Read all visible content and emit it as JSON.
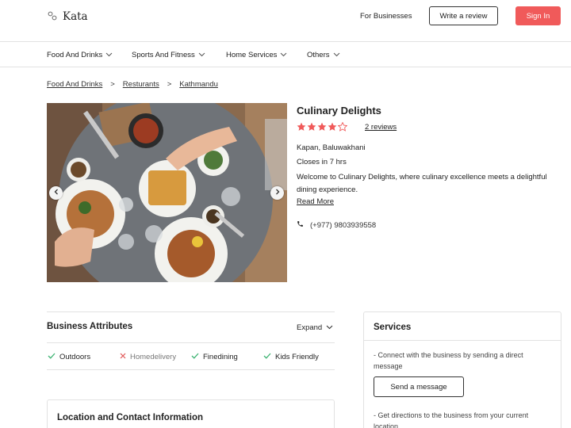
{
  "header": {
    "logo_text": "Kata",
    "for_businesses": "For Businesses",
    "write_review": "Write a review",
    "sign_in": "Sign In"
  },
  "categories": [
    {
      "label": "Food And Drinks",
      "icon": "chevron-down-icon"
    },
    {
      "label": "Sports And Fitness",
      "icon": "chevron-down-icon"
    },
    {
      "label": "Home Services",
      "icon": "chevron-down-icon"
    },
    {
      "label": "Others",
      "icon": "chevron-down-icon"
    }
  ],
  "breadcrumb": {
    "items": [
      "Food And Drinks",
      "Resturants",
      "Kathmandu"
    ],
    "separator": ">"
  },
  "business": {
    "name": "Culinary Delights",
    "rating": 4,
    "rating_max": 5,
    "reviews_label": "2 reviews",
    "address": "Kapan, Baluwakhani",
    "hours_status": "Closes in 7 hrs",
    "description": "Welcome to Culinary Delights, where culinary excellence meets a delightful dining experience.",
    "read_more": "Read More",
    "phone": "(+977) 9803939558"
  },
  "attributes": {
    "title": "Business Attributes",
    "expand_label": "Expand",
    "items": [
      {
        "label": "Outdoors",
        "available": true
      },
      {
        "label": "Homedelivery",
        "available": false
      },
      {
        "label": "Finedining",
        "available": true
      },
      {
        "label": "Kids Friendly",
        "available": true
      }
    ]
  },
  "location": {
    "title": "Location and Contact Information"
  },
  "services": {
    "title": "Services",
    "connect_text": "- Connect with the business by sending a direct message",
    "send_button": "Send a message",
    "directions_text": "- Get directions to the business from your current location"
  },
  "colors": {
    "accent": "#f05a5a",
    "check": "#3cb371",
    "cross": "#e05555"
  }
}
